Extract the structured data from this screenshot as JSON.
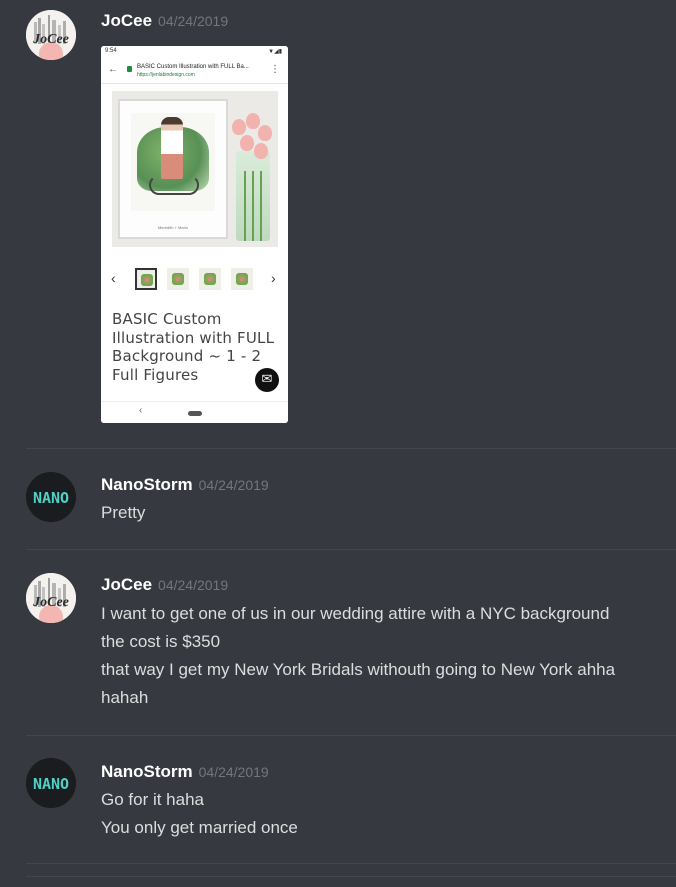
{
  "messages": [
    {
      "username": "JoCee",
      "timestamp": "04/24/2019",
      "avatar_icon": "jocee-avatar",
      "embed": {
        "status_time": "9:54",
        "page_title": "BASIC Custom Illustration with FULL Ba...",
        "page_url": "https://jenlabindesign.com",
        "frame_caption": "Meredith + Mario",
        "product_title": "BASIC Custom Illustration with FULL Background ~ 1 - 2 Full Figures",
        "prev_arrow": "‹",
        "next_arrow": "›"
      }
    },
    {
      "username": "NanoStorm",
      "timestamp": "04/24/2019",
      "avatar_icon": "nano-avatar",
      "avatar_text": "NANO",
      "lines": [
        "Pretty"
      ]
    },
    {
      "username": "JoCee",
      "timestamp": "04/24/2019",
      "avatar_icon": "jocee-avatar",
      "lines": [
        "I want to get one of us in our wedding attire with a NYC background",
        "the cost is $350",
        "that way I get my New York Bridals withouth going to New York ahha",
        "hahah"
      ]
    },
    {
      "username": "NanoStorm",
      "timestamp": "04/24/2019",
      "avatar_icon": "nano-avatar",
      "avatar_text": "NANO",
      "lines": [
        "Go for it haha",
        "You only get married once"
      ]
    }
  ],
  "avatar_text_jocee": "JoCee",
  "colors": {
    "background": "#36393f",
    "username": "#ffffff",
    "timestamp": "#72767d",
    "text": "#dcddde",
    "nano_accent": "#4fd1c5"
  }
}
